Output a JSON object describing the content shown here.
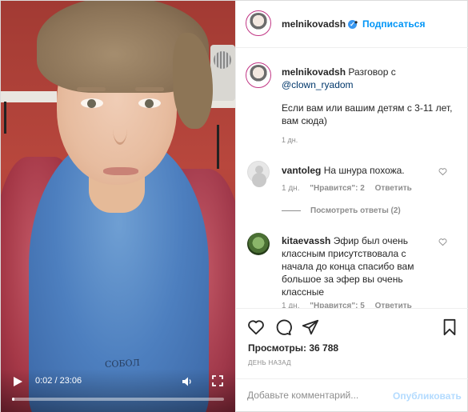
{
  "video": {
    "time_display": "0:02 / 23:06",
    "progress": 0.0015,
    "shirt_print": "СОБОЛ"
  },
  "header": {
    "username": "melnikovadsh",
    "separator": "•",
    "follow_label": "Подписаться"
  },
  "caption": {
    "username": "melnikovadsh",
    "text_lead": "Разговор с",
    "mention": "@clown_ryadom",
    "body": "Если вам или вашим детям с 3-11 лет, вам сюда)",
    "time": "1 дн."
  },
  "comments": [
    {
      "username": "vantoleg",
      "text": "На шнура похожа.",
      "time": "1 дн.",
      "likes": "\"Нравится\": 2",
      "reply_label": "Ответить",
      "view_replies": "Посмотреть ответы (2)"
    },
    {
      "username": "kitaevassh",
      "text": "Эфир был очень классным присутствовала с начала до конца спасибо вам большое за эфер вы очень классные",
      "time": "1 дн.",
      "likes": "\"Нравится\": 5",
      "reply_label": "Ответить"
    }
  ],
  "stats": {
    "views": "Просмотры: 36 788",
    "ago": "ДЕНЬ НАЗАД"
  },
  "comment_box": {
    "placeholder": "Добавьте комментарий...",
    "publish_label": "Опубликовать"
  },
  "colors": {
    "accent": "#0095f6",
    "publish_disabled": "#b3dbff",
    "secondary_text": "#8e8e8e"
  },
  "icons": [
    "play-icon",
    "volume-icon",
    "fullscreen-icon",
    "verified-icon",
    "heart-icon",
    "comment-icon",
    "share-icon",
    "bookmark-icon"
  ]
}
